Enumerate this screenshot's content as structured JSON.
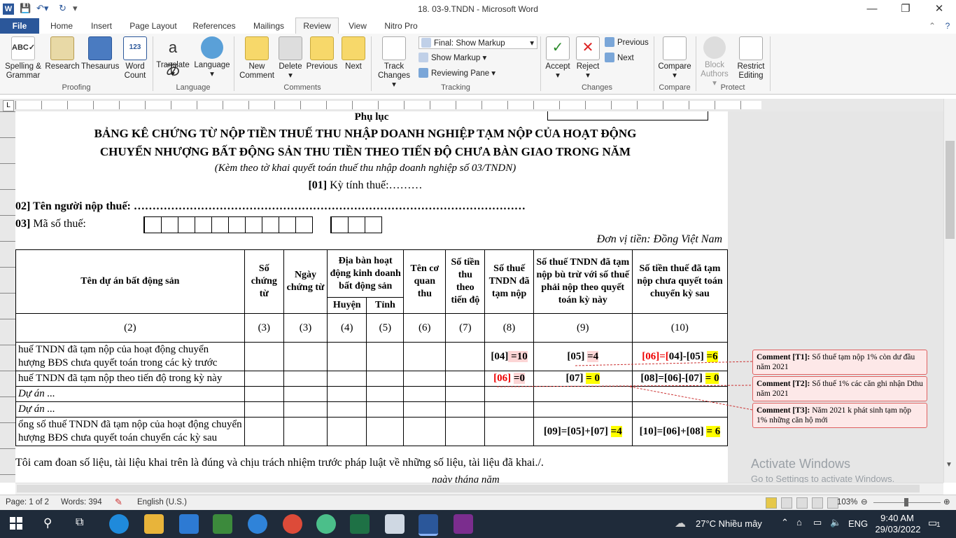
{
  "window": {
    "title": "18. 03-9.TNDN  -  Microsoft Word"
  },
  "tabs": [
    "File",
    "Home",
    "Insert",
    "Page Layout",
    "References",
    "Mailings",
    "Review",
    "View",
    "Nitro Pro"
  ],
  "ribbon": {
    "proofing": {
      "spelling": "Spelling &",
      "spelling2": "Grammar",
      "research": "Research",
      "thesaurus": "Thesaurus",
      "wordcount": "Word",
      "wordcount2": "Count",
      "label": "Proofing"
    },
    "language": {
      "translate": "Translate",
      "language": "Language",
      "label": "Language"
    },
    "comments": {
      "new": "New",
      "new2": "Comment",
      "delete": "Delete",
      "previous": "Previous",
      "next": "Next",
      "label": "Comments"
    },
    "tracking": {
      "track": "Track",
      "track2": "Changes",
      "markup_select": "Final: Show Markup",
      "show_markup": "Show Markup",
      "reviewing_pane": "Reviewing Pane",
      "label": "Tracking"
    },
    "changes": {
      "accept": "Accept",
      "reject": "Reject",
      "previous": "Previous",
      "next": "Next",
      "label": "Changes"
    },
    "compare": {
      "compare": "Compare",
      "label": "Compare"
    },
    "protect": {
      "block": "Block",
      "block2": "Authors",
      "restrict": "Restrict",
      "restrict2": "Editing",
      "label": "Protect"
    }
  },
  "document": {
    "phuluc": "Phụ lục",
    "title1": "BẢNG KÊ CHỨNG TỪ NỘP TIỀN THUẾ THU NHẬP DOANH NGHIỆP TẠM NỘP CỦA HOẠT ĐỘNG",
    "title2": "CHUYỂN NHƯỢNG BẤT ĐỘNG SẢN THU TIỀN THEO TIẾN ĐỘ CHƯA BÀN GIAO TRONG NĂM",
    "subtitle": "(Kèm theo tờ khai quyết toán thuế thu nhập doanh nghiệp số 03/TNDN)",
    "ky_tinh_thue_code": "[01]",
    "ky_tinh_thue": " Kỳ tính thuế:………",
    "nguoi_nop_code": "02]",
    "nguoi_nop": " Tên người nộp thuế: ……………………………………………………………………………………………",
    "ma_so_code": "03]",
    "ma_so": " Mã số thuế:",
    "don_vi": "Đơn vị tiền: Đồng Việt Nam",
    "headers": {
      "h2": "Tên dự án bất động sản",
      "h3": "Số chứng từ",
      "h4": "Ngày chứng từ",
      "h56": "Địa bàn hoạt động kinh doanh bất động sản",
      "h5": "Huyện",
      "h6": "Tỉnh",
      "h7": "Tên cơ quan thu",
      "h8": "Số tiền thu theo tiến độ",
      "h9": "Số thuế TNDN đã tạm nộp",
      "h10": "Số thuế TNDN đã tạm nộp bù trừ với số thuế phải nộp theo quyết toán kỳ này",
      "h11": "Số tiền thuế đã tạm nộp chưa quyết toán chuyển kỳ sau"
    },
    "col_numbers": [
      "(2)",
      "(3)",
      "(3)",
      "(4)",
      "(5)",
      "(6)",
      "(7)",
      "(8)",
      "(9)",
      "(10)"
    ],
    "row1": {
      "label1": "huế TNDN đã tạm nộp của hoạt động chuyển",
      "label2": "hượng BĐS chưa quyết toán trong các kỳ trước",
      "c8a": "[04]",
      "c8b": " =10",
      "c9a": "[05] ",
      "c9b": "=4",
      "c10a": "[06]=[",
      "c10b": "04]-[05] ",
      "c10c": "=6"
    },
    "row2": {
      "label": "huế TNDN đã tạm nộp theo tiến độ trong kỳ này",
      "c8a": "[06] ",
      "c8b": "=0",
      "c9a": "[07] ",
      "c9b": "= 0",
      "c10a": "[08]=[06]-[07] ",
      "c10b": "= 0"
    },
    "row3": {
      "label": "Dự án ..."
    },
    "row4": {
      "label": "Dự án ..."
    },
    "row5": {
      "label1": "ổng số thuế TNDN đã tạm nộp của hoạt động chuyển",
      "label2": "hượng BĐS chưa quyết toán chuyển các kỳ sau",
      "c9a": "[09]=[05]+[07] ",
      "c9b": "=4",
      "c10a": "[10]=[06]+[08] ",
      "c10b": "= 6"
    },
    "footer": "Tôi cam đoan số liệu, tài liệu khai trên là đúng và chịu trách nhiệm trước pháp luật về những số liệu, tài liệu đã khai./.",
    "date_line": "ngày          tháng          năm"
  },
  "comments": [
    {
      "tag": "Comment [T1]:",
      "text": " Số thuế tạm nộp 1% còn dư đầu năm 2021"
    },
    {
      "tag": "Comment [T2]:",
      "text": " Số thuế 1% các căn ghi nhận Dthu năm 2021"
    },
    {
      "tag": "Comment [T3]:",
      "text": " Năm 2021 k phát sinh tạm nộp 1% những căn hộ mới"
    }
  ],
  "watermark": {
    "line1": "Activate Windows",
    "line2": "Go to Settings to activate Windows."
  },
  "status": {
    "page": "Page: 1 of 2",
    "words": "Words: 394",
    "lang": "English (U.S.)",
    "zoom": "103%"
  },
  "taskbar": {
    "weather": "27°C  Nhiều mây",
    "lang": "ENG",
    "time": "9:40 AM",
    "date": "29/03/2022",
    "notif": "1"
  }
}
